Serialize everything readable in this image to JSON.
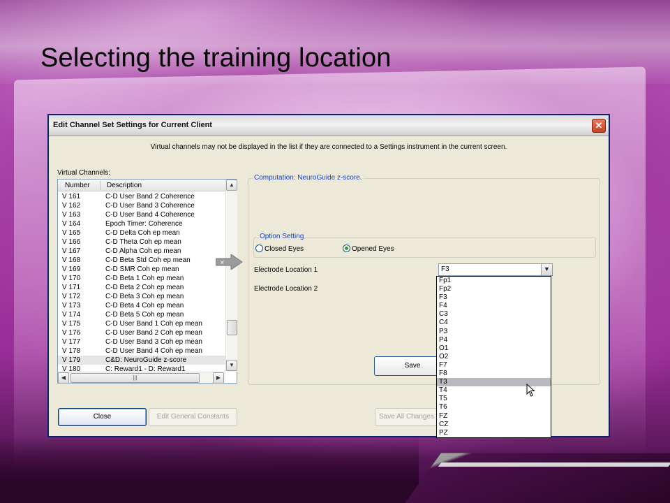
{
  "slide": {
    "title": "Selecting the training location"
  },
  "dialog": {
    "title": "Edit Channel Set Settings for Current Client",
    "close_glyph": "✕",
    "info_text": "Virtual channels may not be displayed in the list if they are connected to a Settings instrument in the current screen.",
    "virtual_channels_label": "Virtual Channels:",
    "columns": [
      "Number",
      "Description"
    ],
    "rows": [
      {
        "number": "V 161",
        "description": "C-D User Band 2 Coherence"
      },
      {
        "number": "V 162",
        "description": "C-D User Band 3 Coherence"
      },
      {
        "number": "V 163",
        "description": "C-D User Band 4 Coherence"
      },
      {
        "number": "V 164",
        "description": "Epoch Timer: Coherence"
      },
      {
        "number": "V 165",
        "description": "C-D Delta Coh ep mean"
      },
      {
        "number": "V 166",
        "description": "C-D Theta Coh ep mean"
      },
      {
        "number": "V 167",
        "description": "C-D Alpha Coh ep mean"
      },
      {
        "number": "V 168",
        "description": "C-D Beta Std Coh ep mean"
      },
      {
        "number": "V 169",
        "description": "C-D SMR Coh ep mean"
      },
      {
        "number": "V 170",
        "description": "C-D Beta 1 Coh ep mean"
      },
      {
        "number": "V 171",
        "description": "C-D Beta 2 Coh ep mean"
      },
      {
        "number": "V 172",
        "description": "C-D Beta 3 Coh ep mean"
      },
      {
        "number": "V 173",
        "description": "C-D Beta 4 Coh ep mean"
      },
      {
        "number": "V 174",
        "description": "C-D Beta 5 Coh ep mean"
      },
      {
        "number": "V 175",
        "description": "C-D User Band 1 Coh ep mean"
      },
      {
        "number": "V 176",
        "description": "C-D User Band 2 Coh ep mean"
      },
      {
        "number": "V 177",
        "description": "C-D User Band 3 Coh ep mean"
      },
      {
        "number": "V 178",
        "description": "C-D User Band 4 Coh ep mean"
      },
      {
        "number": "V 179",
        "description": "C&D: NeuroGuide z-score",
        "selected": true
      },
      {
        "number": "V 180",
        "description": "C: Reward1 - D: Reward1"
      }
    ],
    "computation_label": "Computation: NeuroGuide z-score.",
    "option_setting_label": "Option Setting",
    "radio_closed_eyes": "Closed Eyes",
    "radio_opened_eyes": "Opened Eyes",
    "selected_option": "Opened Eyes",
    "electrode_location_1_label": "Electrode Location 1",
    "electrode_location_2_label": "Electrode Location 2",
    "electrode_location_1_value": "F3",
    "dropdown_options": [
      "Fp1",
      "Fp2",
      "F3",
      "F4",
      "C3",
      "C4",
      "P3",
      "P4",
      "O1",
      "O2",
      "F7",
      "F8",
      "T3",
      "T4",
      "T5",
      "T6",
      "FZ",
      "CZ",
      "PZ"
    ],
    "highlighted_option": "T3",
    "save_button_label": "Save",
    "close_button_label": "Close",
    "edit_general_constants_label": "Edit General Constants",
    "save_all_changes_label": "Save All Changes to"
  },
  "colors": {
    "group_label": "#1a40c0",
    "dialog_bg": "#ece9d8",
    "highlight": "#b9b9c0"
  }
}
